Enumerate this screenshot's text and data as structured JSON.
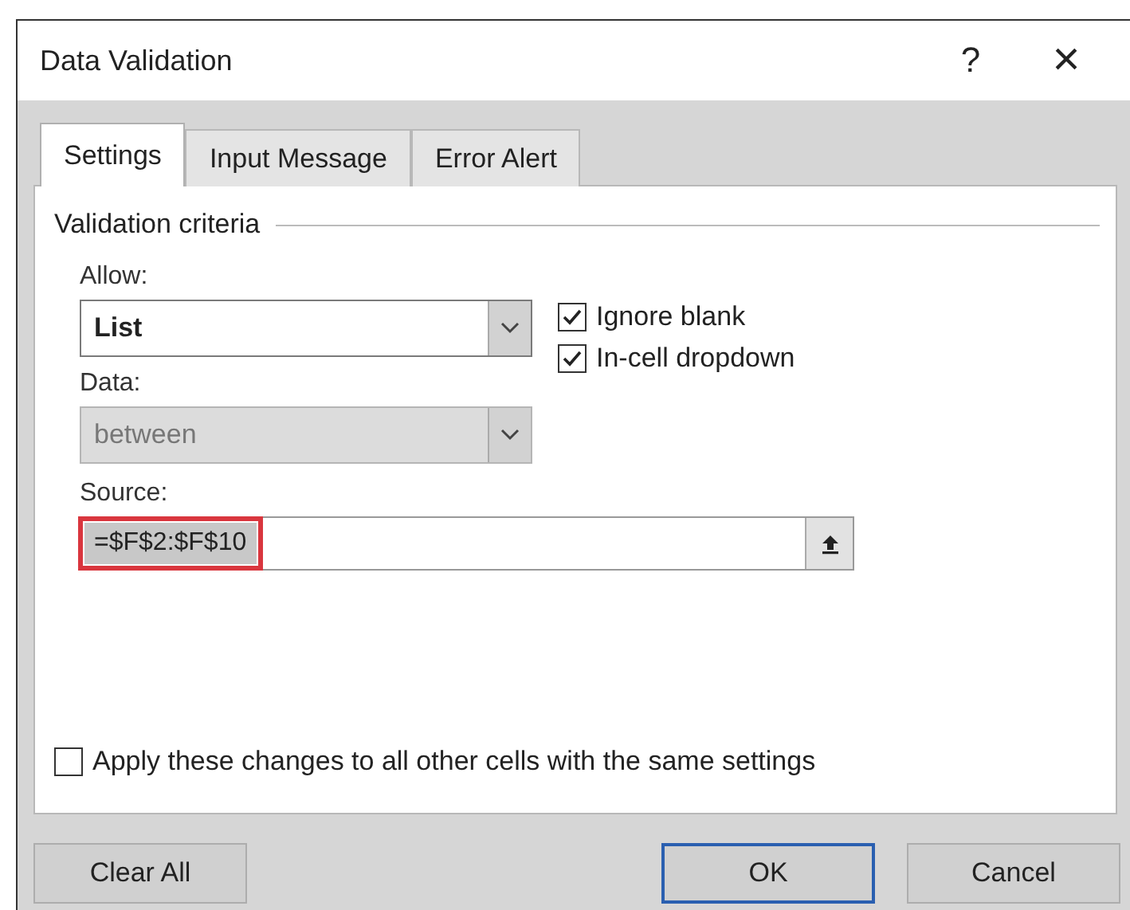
{
  "window": {
    "title": "Data Validation",
    "help": "?",
    "close": "×"
  },
  "tabs": [
    {
      "label": "Settings",
      "selected": true
    },
    {
      "label": "Input Message",
      "selected": false
    },
    {
      "label": "Error Alert",
      "selected": false
    }
  ],
  "group": {
    "title": "Validation criteria"
  },
  "allow": {
    "label": "Allow:",
    "value": "List",
    "disabled": false
  },
  "data": {
    "label": "Data:",
    "value": "between",
    "disabled": true
  },
  "checkboxes": [
    {
      "label": "Ignore blank",
      "checked": true
    },
    {
      "label": "In-cell dropdown",
      "checked": true
    }
  ],
  "source": {
    "label": "Source:",
    "value": "=$F$2:$F$10",
    "highlighted": true
  },
  "apply_all": {
    "label": "Apply these changes to all other cells with the same settings",
    "checked": false
  },
  "buttons": [
    {
      "label": "Clear All",
      "default": false
    },
    {
      "label": "OK",
      "default": true
    },
    {
      "label": "Cancel",
      "default": false
    }
  ]
}
